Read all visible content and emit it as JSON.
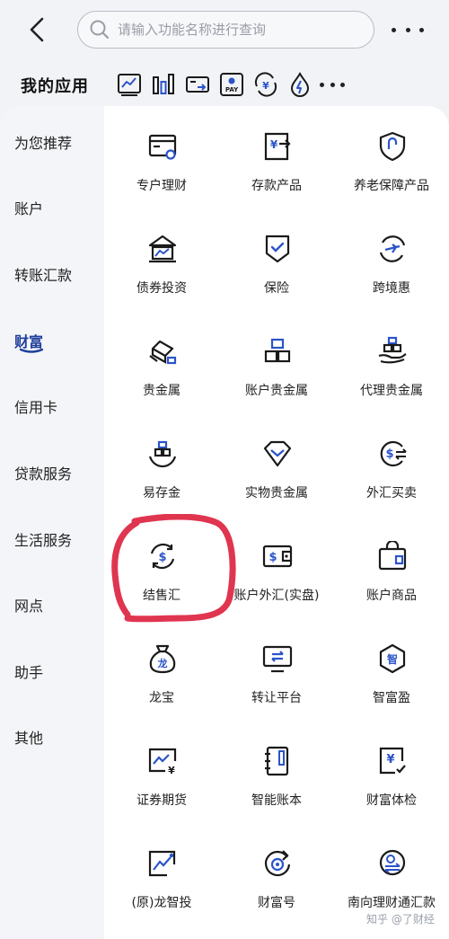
{
  "search": {
    "placeholder": "请输入功能名称进行查询"
  },
  "apps": {
    "title": "我的应用",
    "shortcuts": [
      "chart-line-icon",
      "bar-chart-icon",
      "card-transfer-icon",
      "pay-icon",
      "currency-exchange-icon",
      "flash-water-icon"
    ]
  },
  "sidebar": {
    "items": [
      {
        "label": "为您推荐"
      },
      {
        "label": "账户"
      },
      {
        "label": "转账汇款"
      },
      {
        "label": "财富"
      },
      {
        "label": "信用卡"
      },
      {
        "label": "贷款服务"
      },
      {
        "label": "生活服务"
      },
      {
        "label": "网点"
      },
      {
        "label": "助手"
      },
      {
        "label": "其他"
      }
    ],
    "active": "财富"
  },
  "grid": {
    "items": [
      {
        "label": "专户理财",
        "icon": "card-coin-icon"
      },
      {
        "label": "存款产品",
        "icon": "deposit-yen-icon"
      },
      {
        "label": "养老保障产品",
        "icon": "pension-shield-icon"
      },
      {
        "label": "债券投资",
        "icon": "bond-building-icon"
      },
      {
        "label": "保险",
        "icon": "insurance-shield-icon"
      },
      {
        "label": "跨境惠",
        "icon": "cross-border-plane-icon"
      },
      {
        "label": "贵金属",
        "icon": "precious-metal-icon"
      },
      {
        "label": "账户贵金属",
        "icon": "account-gold-icon"
      },
      {
        "label": "代理贵金属",
        "icon": "agency-gold-icon"
      },
      {
        "label": "易存金",
        "icon": "easy-gold-icon"
      },
      {
        "label": "实物贵金属",
        "icon": "diamond-icon"
      },
      {
        "label": "外汇买卖",
        "icon": "forex-trade-icon"
      },
      {
        "label": "结售汇",
        "icon": "exchange-dollar-icon"
      },
      {
        "label": "账户外汇(实盘)",
        "icon": "wallet-dollar-icon"
      },
      {
        "label": "账户商品",
        "icon": "commodity-bag-icon"
      },
      {
        "label": "龙宝",
        "icon": "dragon-bag-icon"
      },
      {
        "label": "转让平台",
        "icon": "transfer-platform-icon"
      },
      {
        "label": "智富盈",
        "icon": "wisdom-badge-icon"
      },
      {
        "label": "证券期货",
        "icon": "securities-chart-icon"
      },
      {
        "label": "智能账本",
        "icon": "smart-ledger-icon"
      },
      {
        "label": "财富体检",
        "icon": "wealth-checkup-icon"
      },
      {
        "label": "(原)龙智投",
        "icon": "robo-invest-icon"
      },
      {
        "label": "财富号",
        "icon": "wealth-account-icon"
      },
      {
        "label": "南向理财通汇款",
        "icon": "southbound-remit-icon"
      }
    ]
  },
  "watermark": "知乎 @了财经",
  "colors": {
    "icon_dark": "#1a1a1a",
    "icon_blue": "#2b54c9",
    "active_text": "#1f3f9b",
    "marker_red": "#e0354f"
  }
}
